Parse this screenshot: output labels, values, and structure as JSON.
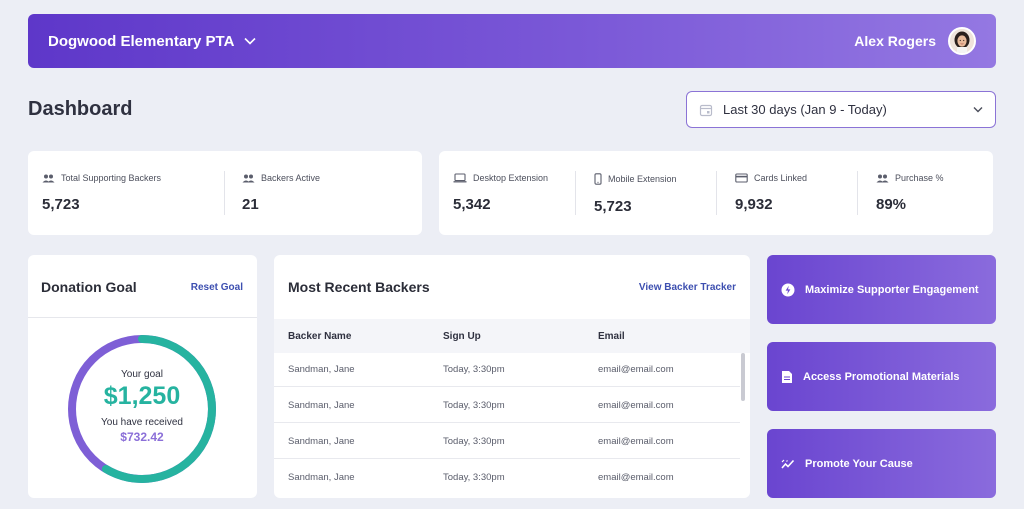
{
  "header": {
    "org_name": "Dogwood Elementary PTA",
    "user_name": "Alex Rogers"
  },
  "page": {
    "title": "Dashboard"
  },
  "date_range": {
    "selected": "Last 30 days (Jan 9 - Today)"
  },
  "stats_left": [
    {
      "label": "Total Supporting Backers",
      "value": "5,723",
      "icon": "users-icon"
    },
    {
      "label": "Backers Active",
      "value": "21",
      "icon": "users-icon"
    }
  ],
  "stats_right": [
    {
      "label": "Desktop Extension",
      "value": "5,342",
      "icon": "laptop-icon"
    },
    {
      "label": "Mobile Extension",
      "value": "5,723",
      "icon": "mobile-icon"
    },
    {
      "label": "Cards Linked",
      "value": "9,932",
      "icon": "credit-card-icon"
    },
    {
      "label": "Purchase %",
      "value": "89%",
      "icon": "users-icon"
    }
  ],
  "donation": {
    "title": "Donation Goal",
    "reset_label": "Reset Goal",
    "goal_label": "Your goal",
    "goal_value": "$1,250",
    "received_label": "You have received",
    "received_value": "$732.42",
    "progress_fraction": 0.586,
    "colors": {
      "progress": "#26b3a0",
      "remaining": "#7e5fd6"
    }
  },
  "backers": {
    "title": "Most Recent Backers",
    "link_label": "View Backer Tracker",
    "columns": [
      "Backer Name",
      "Sign Up",
      "Email"
    ],
    "rows": [
      [
        "Sandman, Jane",
        "Today, 3:30pm",
        "email@email.com"
      ],
      [
        "Sandman, Jane",
        "Today, 3:30pm",
        "email@email.com"
      ],
      [
        "Sandman, Jane",
        "Today, 3:30pm",
        "email@email.com"
      ],
      [
        "Sandman, Jane",
        "Today, 3:30pm",
        "email@email.com"
      ]
    ]
  },
  "actions": [
    {
      "label": "Maximize Supporter Engagement",
      "icon": "lightning-icon"
    },
    {
      "label": "Access Promotional Materials",
      "icon": "document-icon"
    },
    {
      "label": "Promote Your Cause",
      "icon": "trend-icon"
    }
  ],
  "colors": {
    "brand": "#6a45d0",
    "accent_link": "#3d4fb0",
    "background": "#eceef5"
  }
}
